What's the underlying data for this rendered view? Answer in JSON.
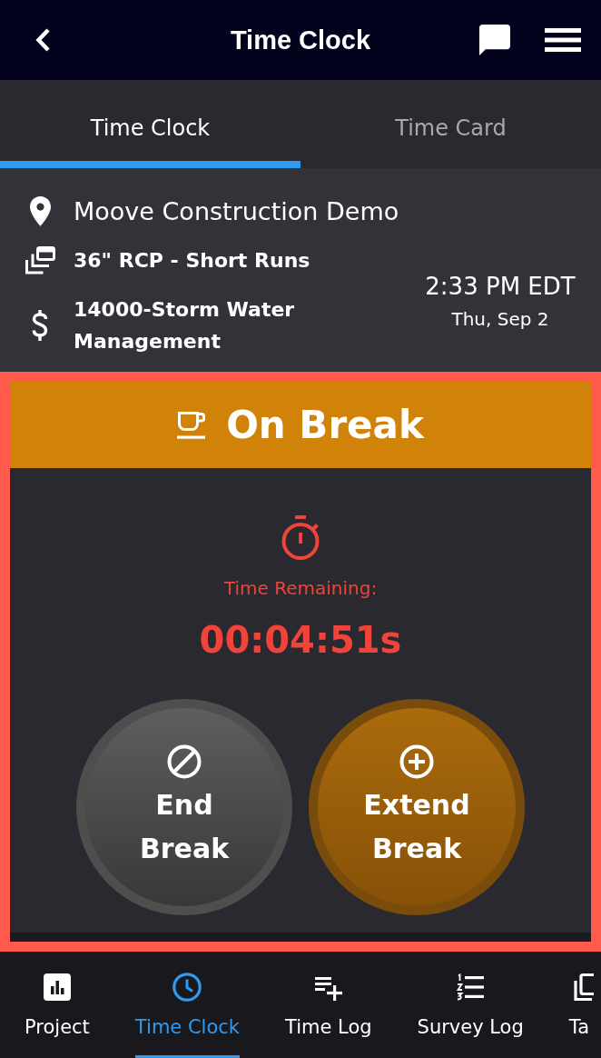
{
  "header": {
    "title": "Time Clock"
  },
  "tabs": [
    {
      "label": "Time Clock",
      "selected": true
    },
    {
      "label": "Time Card",
      "selected": false
    }
  ],
  "job_info": {
    "items": [
      {
        "kind": "location",
        "text": "Moove Construction Demo"
      },
      {
        "kind": "phase",
        "text": "36\" RCP - Short Runs"
      },
      {
        "kind": "cost_code",
        "text": "14000-Storm Water Management"
      }
    ],
    "time": "2:33 PM EDT",
    "date": "Thu, Sep 2"
  },
  "break_panel": {
    "status": "On Break",
    "timer_label": "Time Remaining:",
    "timer_value": "00:04:51s",
    "actions": [
      {
        "kind": "end",
        "label": "End Break"
      },
      {
        "kind": "extend",
        "label": "Extend Break"
      }
    ]
  },
  "bottom_nav": [
    {
      "kind": "chart",
      "label": "Project",
      "selected": false
    },
    {
      "kind": "clock",
      "label": "Time Clock",
      "selected": true
    },
    {
      "kind": "list_add",
      "label": "Time Log",
      "selected": false
    },
    {
      "kind": "numbered_list",
      "label": "Survey Log",
      "selected": false
    },
    {
      "kind": "copy",
      "label": "Ta",
      "selected": false
    }
  ]
}
